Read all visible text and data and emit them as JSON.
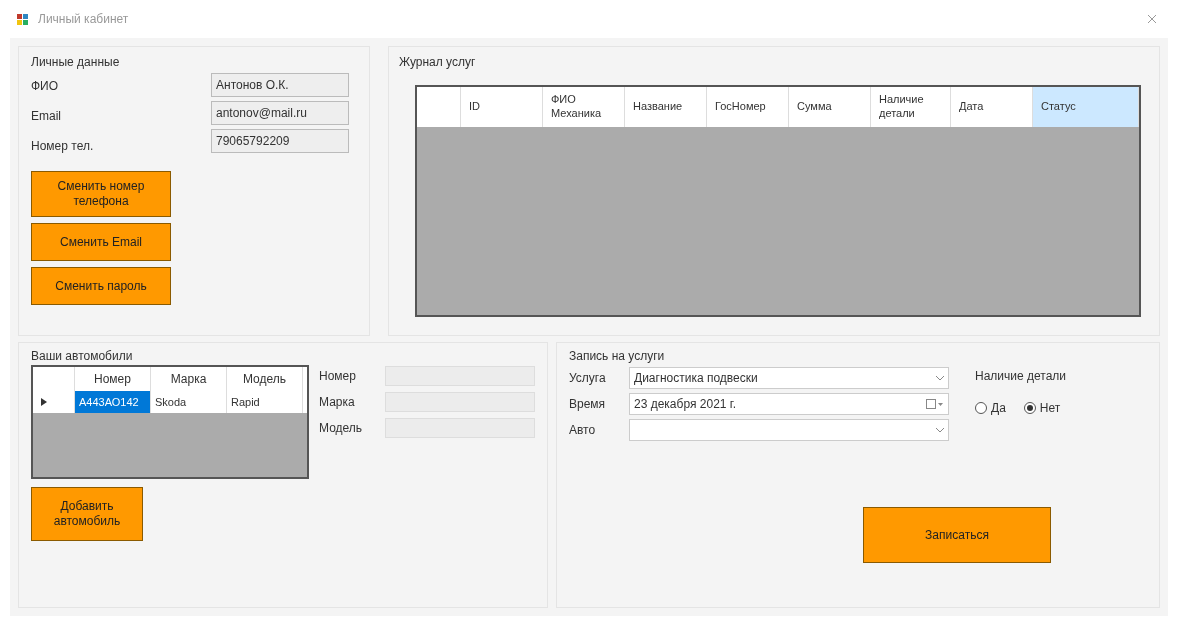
{
  "window": {
    "title": "Личный кабинет"
  },
  "personal": {
    "title": "Личные данные",
    "fields": [
      {
        "label": "ФИО",
        "value": "Антонов О.К."
      },
      {
        "label": "Email",
        "value": "antonov@mail.ru"
      },
      {
        "label": "Номер тел.",
        "value": "79065792209"
      }
    ],
    "buttons": [
      "Сменить номер телефона",
      "Сменить Email",
      "Сменить пароль"
    ]
  },
  "journal": {
    "title": "Журнал услуг",
    "columns": [
      {
        "label": "ID",
        "selected": false
      },
      {
        "label": "ФИО Механика",
        "selected": false
      },
      {
        "label": "Название",
        "selected": false
      },
      {
        "label": "ГосНомер",
        "selected": false
      },
      {
        "label": "Сумма",
        "selected": false
      },
      {
        "label": "Наличие детали",
        "selected": false
      },
      {
        "label": "Дата",
        "selected": false
      },
      {
        "label": "Статус",
        "selected": true
      }
    ]
  },
  "cars": {
    "title": "Ваши автомобили",
    "columns": [
      "Номер",
      "Марка",
      "Модель"
    ],
    "rows": [
      {
        "cells": [
          {
            "text": "А443АО142",
            "selected": true
          },
          {
            "text": "Skoda",
            "selected": false
          },
          {
            "text": "Rapid",
            "selected": false
          }
        ],
        "current": true
      }
    ],
    "fields": [
      {
        "label": "Номер"
      },
      {
        "label": "Марка"
      },
      {
        "label": "Модель"
      }
    ],
    "button": "Добавить автомобиль"
  },
  "booking": {
    "title": "Запись на услуги",
    "fields": [
      {
        "kind": "combo",
        "label": "Услуга",
        "value": "Диагностика подвески"
      },
      {
        "kind": "date",
        "label": "Время",
        "value": "23 декабря 2021 г."
      },
      {
        "kind": "combo",
        "label": "Авто"
      }
    ],
    "part": {
      "title": "Наличие детали",
      "options": [
        {
          "label": "Да",
          "selected": false
        },
        {
          "label": "Нет",
          "selected": true
        }
      ]
    },
    "button": "Записаться"
  }
}
